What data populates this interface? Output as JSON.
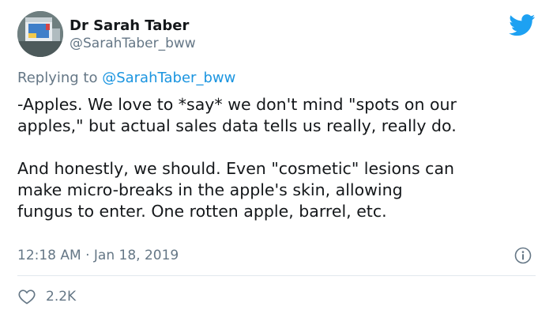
{
  "author": {
    "name": "Dr Sarah Taber",
    "handle": "@SarahTaber_bww"
  },
  "replying": {
    "prefix": "Replying to ",
    "mention": "@SarahTaber_bww"
  },
  "body": {
    "line1": "-Apples. We love to *say* we don't mind \"spots on our",
    "line2": "apples,\" but actual sales data tells us really, really do.",
    "line3": "And honestly, we should. Even \"cosmetic\" lesions can",
    "line4": "make micro-breaks in the apple's skin, allowing",
    "line5": "fungus to enter. One rotten apple, barrel, etc."
  },
  "meta": {
    "time": "12:18 AM",
    "separator": " · ",
    "date": "Jan 18, 2019"
  },
  "likes": {
    "count": "2.2K"
  },
  "icons": {
    "brand": "twitter-bird-icon",
    "info": "info-icon",
    "like": "heart-icon"
  },
  "colors": {
    "brand_blue": "#1da1f2",
    "link_blue": "#1b95e0",
    "secondary_text": "#657786",
    "divider": "#e1e8ed"
  }
}
